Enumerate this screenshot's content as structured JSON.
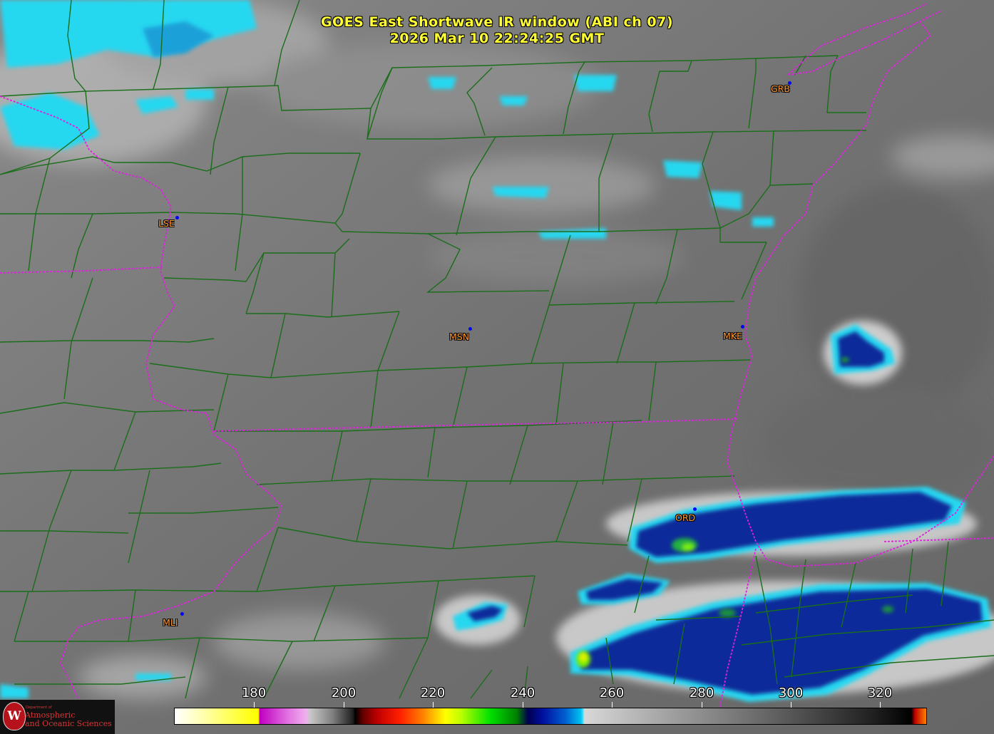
{
  "header": {
    "title_line1": "GOES East Shortwave IR window (ABI ch 07)",
    "title_line2": "2026 Mar 10  22:24:25 GMT"
  },
  "colors": {
    "title": "#ffff33",
    "station_label": "#ff9a33",
    "station_dot": "#0000ff",
    "county_lines": "#1a6e1a",
    "state_lines": "#e020e0"
  },
  "stations": [
    {
      "id": "GRB",
      "label": "GRB"
    },
    {
      "id": "LSE",
      "label": "LSE"
    },
    {
      "id": "MSN",
      "label": "MSN"
    },
    {
      "id": "MKE",
      "label": "MKE"
    },
    {
      "id": "ORD",
      "label": "ORD"
    },
    {
      "id": "MLI",
      "label": "MLI"
    }
  ],
  "colorbar": {
    "ticks": [
      "180",
      "200",
      "220",
      "240",
      "260",
      "280",
      "300",
      "320"
    ]
  },
  "logo": {
    "seal_letter": "W",
    "dept_text": "Department of",
    "line1": "Atmospheric",
    "line2": "and Oceanic Sciences"
  }
}
